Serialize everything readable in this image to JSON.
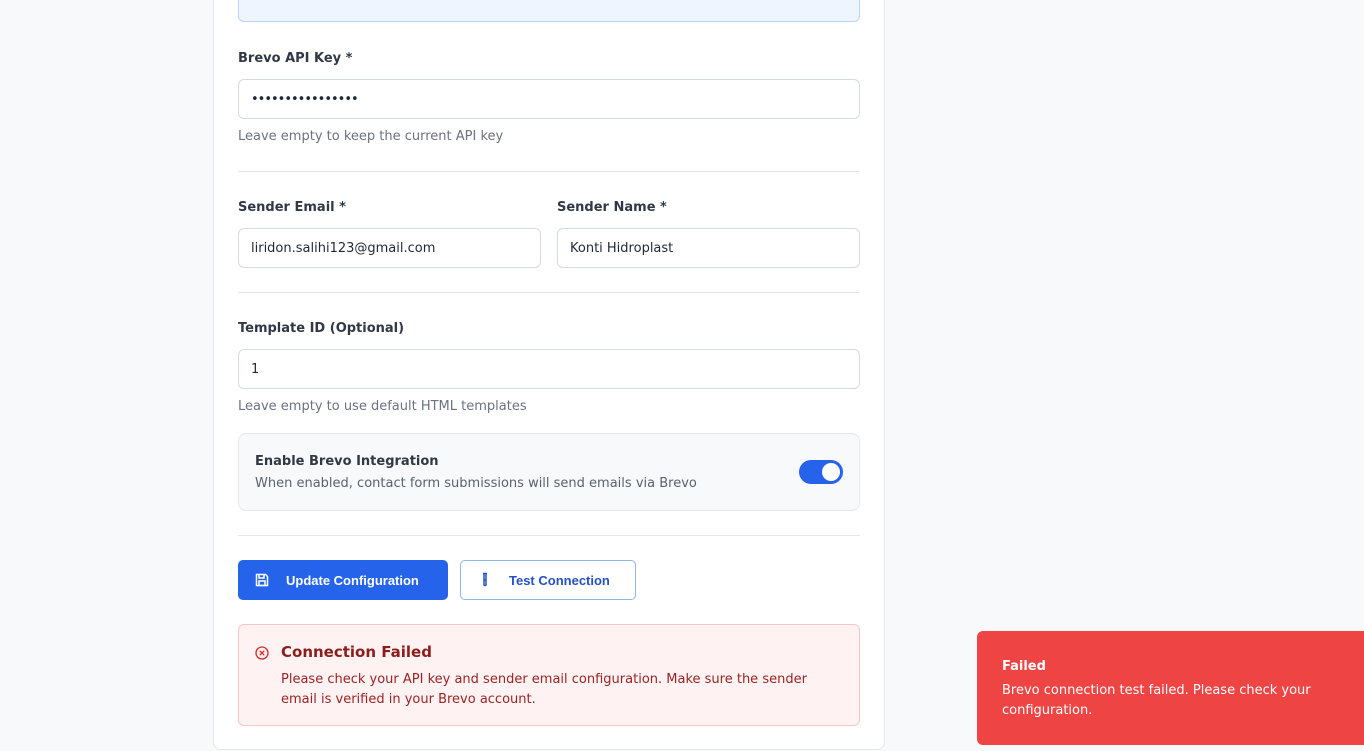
{
  "form": {
    "api_key": {
      "label": "Brevo API Key *",
      "value": "••••••••••••••••",
      "hint": "Leave empty to keep the current API key"
    },
    "sender_email": {
      "label": "Sender Email *",
      "value": "liridon.salihi123@gmail.com"
    },
    "sender_name": {
      "label": "Sender Name *",
      "value": "Konti Hidroplast"
    },
    "template_id": {
      "label": "Template ID (Optional)",
      "value": "1",
      "hint": "Leave empty to use default HTML templates"
    },
    "integration": {
      "title": "Enable Brevo Integration",
      "description": "When enabled, contact form submissions will send emails via Brevo",
      "enabled": true
    }
  },
  "actions": {
    "update_label": "Update Configuration",
    "test_label": "Test Connection",
    "update_icon": "save-icon",
    "test_icon": "test-tube-icon"
  },
  "alert": {
    "icon": "x-circle-icon",
    "title": "Connection Failed",
    "message": "Please check your API key and sender email configuration. Make sure the sender email is verified in your Brevo account."
  },
  "toast": {
    "title": "Failed",
    "message": "Brevo connection test failed. Please check your configuration."
  },
  "colors": {
    "primary": "#2563eb",
    "error": "#ef4444",
    "alert_bg": "#fef2f2"
  }
}
